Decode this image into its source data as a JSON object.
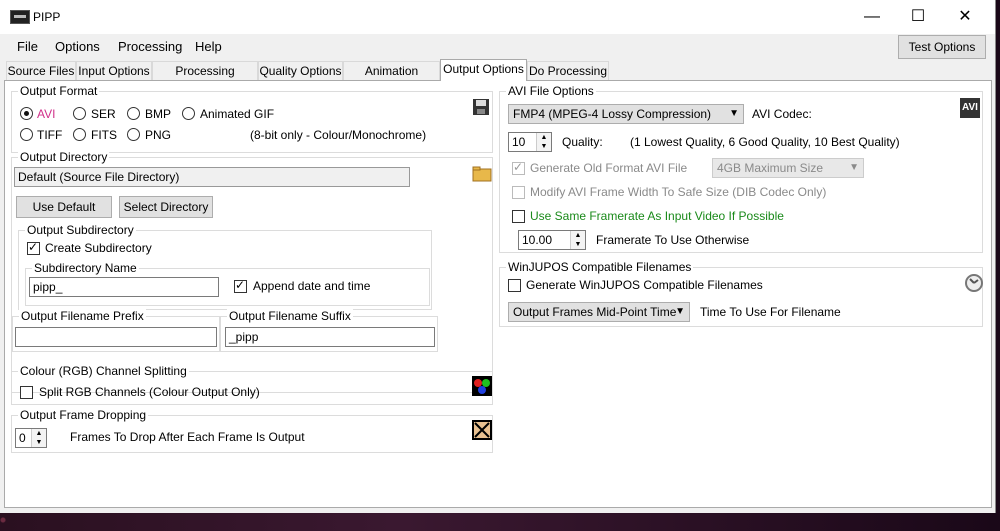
{
  "window": {
    "title": "PIPP",
    "minimize": "—",
    "maximize": "☐",
    "close": "✕"
  },
  "menu": {
    "file": "File",
    "options": "Options",
    "processing": "Processing",
    "help": "Help",
    "test_options": "Test Options"
  },
  "tabs": [
    {
      "label": "Source Files"
    },
    {
      "label": "Input Options"
    },
    {
      "label": "Processing Options"
    },
    {
      "label": "Quality Options"
    },
    {
      "label": "Animation Options"
    },
    {
      "label": "Output Options"
    },
    {
      "label": "Do Processing"
    }
  ],
  "output_format": {
    "legend": "Output Format",
    "avi": "AVI",
    "ser": "SER",
    "bmp": "BMP",
    "gif": "Animated GIF",
    "tiff": "TIFF",
    "fits": "FITS",
    "png": "PNG",
    "note": "(8-bit only - Colour/Monochrome)"
  },
  "output_directory": {
    "legend": "Output Directory",
    "value": "Default (Source File Directory)",
    "use_default": "Use Default",
    "select_directory": "Select Directory"
  },
  "output_subdirectory": {
    "legend": "Output Subdirectory",
    "create": "Create Subdirectory",
    "name_legend": "Subdirectory Name",
    "name_value": "pipp_",
    "append": "Append date and time"
  },
  "filename_prefix": {
    "legend": "Output Filename Prefix",
    "value": ""
  },
  "filename_suffix": {
    "legend": "Output Filename Suffix",
    "value": "_pipp"
  },
  "channel_split": {
    "legend": "Colour (RGB) Channel Splitting",
    "label": "Split RGB Channels (Colour Output Only)"
  },
  "frame_drop": {
    "legend": "Output Frame Dropping",
    "value": "0",
    "label": "Frames To Drop After Each Frame Is Output"
  },
  "avi_options": {
    "legend": "AVI File Options",
    "codec_value": "FMP4 (MPEG-4 Lossy Compression)",
    "codec_label": "AVI Codec:",
    "quality_value": "10",
    "quality_label": "Quality:",
    "quality_hint": "(1 Lowest Quality, 6 Good Quality, 10 Best Quality)",
    "old_format": "Generate Old Format AVI File",
    "max_size": "4GB Maximum Size",
    "modify_width": "Modify AVI Frame Width To Safe Size (DIB Codec Only)",
    "same_framerate": "Use Same Framerate As Input Video If Possible",
    "framerate_value": "10.00",
    "framerate_label": "Framerate To Use Otherwise",
    "avi_badge": "AVI"
  },
  "winjupos": {
    "legend": "WinJUPOS Compatible Filenames",
    "generate": "Generate WinJUPOS Compatible Filenames",
    "time_value": "Output Frames Mid-Point Time",
    "time_label": "Time To Use For Filename"
  }
}
